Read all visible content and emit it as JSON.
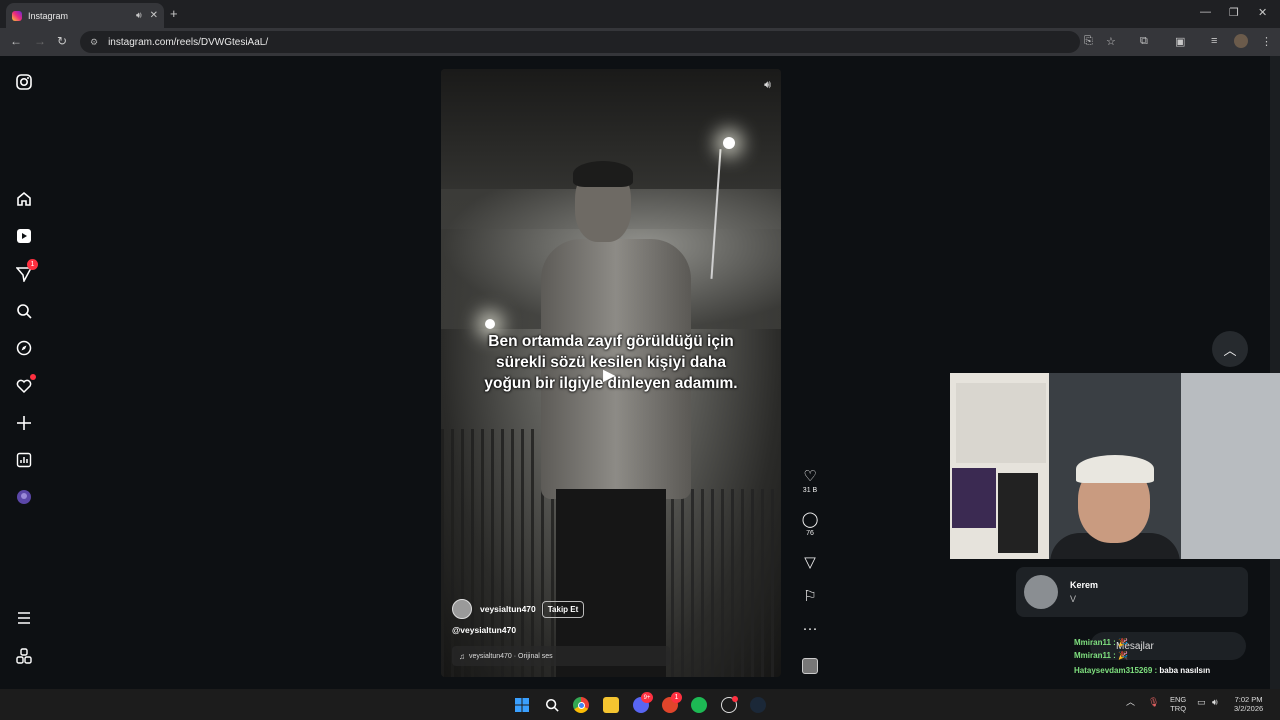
{
  "browser": {
    "tab_title": "Instagram",
    "url": "instagram.com/reels/DVWGtesiAaL/"
  },
  "sidebar": {
    "messages_badge": "1"
  },
  "reel": {
    "caption": "Ben ortamda zayıf görüldüğü için sürekli sözü kesilen kişiyi daha yoğun bir ilgiyle dinleyen adamım.",
    "author": "veysialtun470",
    "follow_label": "Takip Et",
    "mention": "@veysialtun470",
    "audio": "veysialtun470 · Orijinal ses",
    "likes": "31 B",
    "comments": "76"
  },
  "overlay": {
    "toast_name": "Kerem",
    "toast_message": "V",
    "messages_label": "Mesajlar",
    "chat": [
      {
        "user": "Mmiran11 :",
        "text": "🎉"
      },
      {
        "user": "Mmiran11 :",
        "text": "🎉"
      },
      {
        "user": "Hataysevdam315269 :",
        "text": "baba nasılsın"
      }
    ]
  },
  "taskbar": {
    "lang_top": "ENG",
    "lang_bottom": "TRQ",
    "time": "7:02 PM",
    "date": "3/2/2026",
    "discord_badge": "9+",
    "app_badge": "1"
  }
}
